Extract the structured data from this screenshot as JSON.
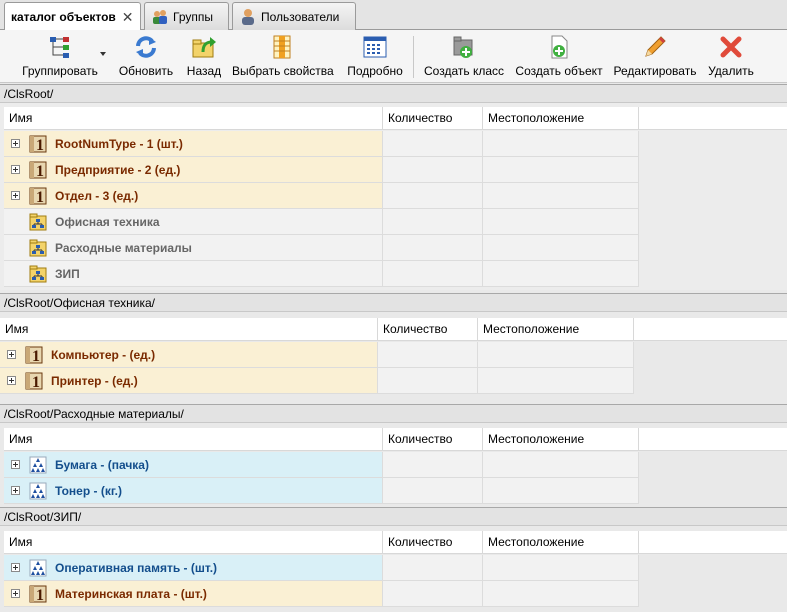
{
  "tabs": [
    {
      "label": "каталог объектов",
      "active": true,
      "icon": "close-icon"
    },
    {
      "label": "Группы",
      "icon": "group-users-icon"
    },
    {
      "label": "Пользователи",
      "icon": "user-icon"
    }
  ],
  "toolbar": {
    "group": "Группировать",
    "refresh": "Обновить",
    "back": "Назад",
    "select_props": "Выбрать свойства",
    "details": "Подробно",
    "create_class": "Создать класс",
    "create_object": "Создать объект",
    "edit": "Редактировать",
    "delete": "Удалить"
  },
  "columns": {
    "name": "Имя",
    "qty": "Количество",
    "location": "Местоположение"
  },
  "panels": [
    {
      "path": "/ClsRoot/",
      "rows": [
        {
          "text": "RootNumType - 1 (шт.)",
          "kind": "cls"
        },
        {
          "text": "Предприятие - 2 (ед.)",
          "kind": "cls"
        },
        {
          "text": "Отдел - 3 (ед.)",
          "kind": "cls"
        },
        {
          "text": "Офисная техника",
          "kind": "fold"
        },
        {
          "text": "Расходные материалы",
          "kind": "fold"
        },
        {
          "text": "ЗИП",
          "kind": "fold"
        }
      ]
    },
    {
      "path": "/ClsRoot/Офисная техника/",
      "rows": [
        {
          "text": "Компьютер -  (ед.)",
          "kind": "cls"
        },
        {
          "text": "Принтер -  (ед.)",
          "kind": "cls"
        }
      ]
    },
    {
      "path": "/ClsRoot/Расходные материалы/",
      "rows": [
        {
          "text": "Бумага -  (пачка)",
          "kind": "num"
        },
        {
          "text": "Тонер -  (кг.)",
          "kind": "num"
        }
      ]
    },
    {
      "path": "/ClsRoot/ЗИП/",
      "rows": [
        {
          "text": "Оперативная память -  (шт.)",
          "kind": "num"
        },
        {
          "text": "Материнская плата -  (шт.)",
          "kind": "cls"
        }
      ]
    }
  ]
}
